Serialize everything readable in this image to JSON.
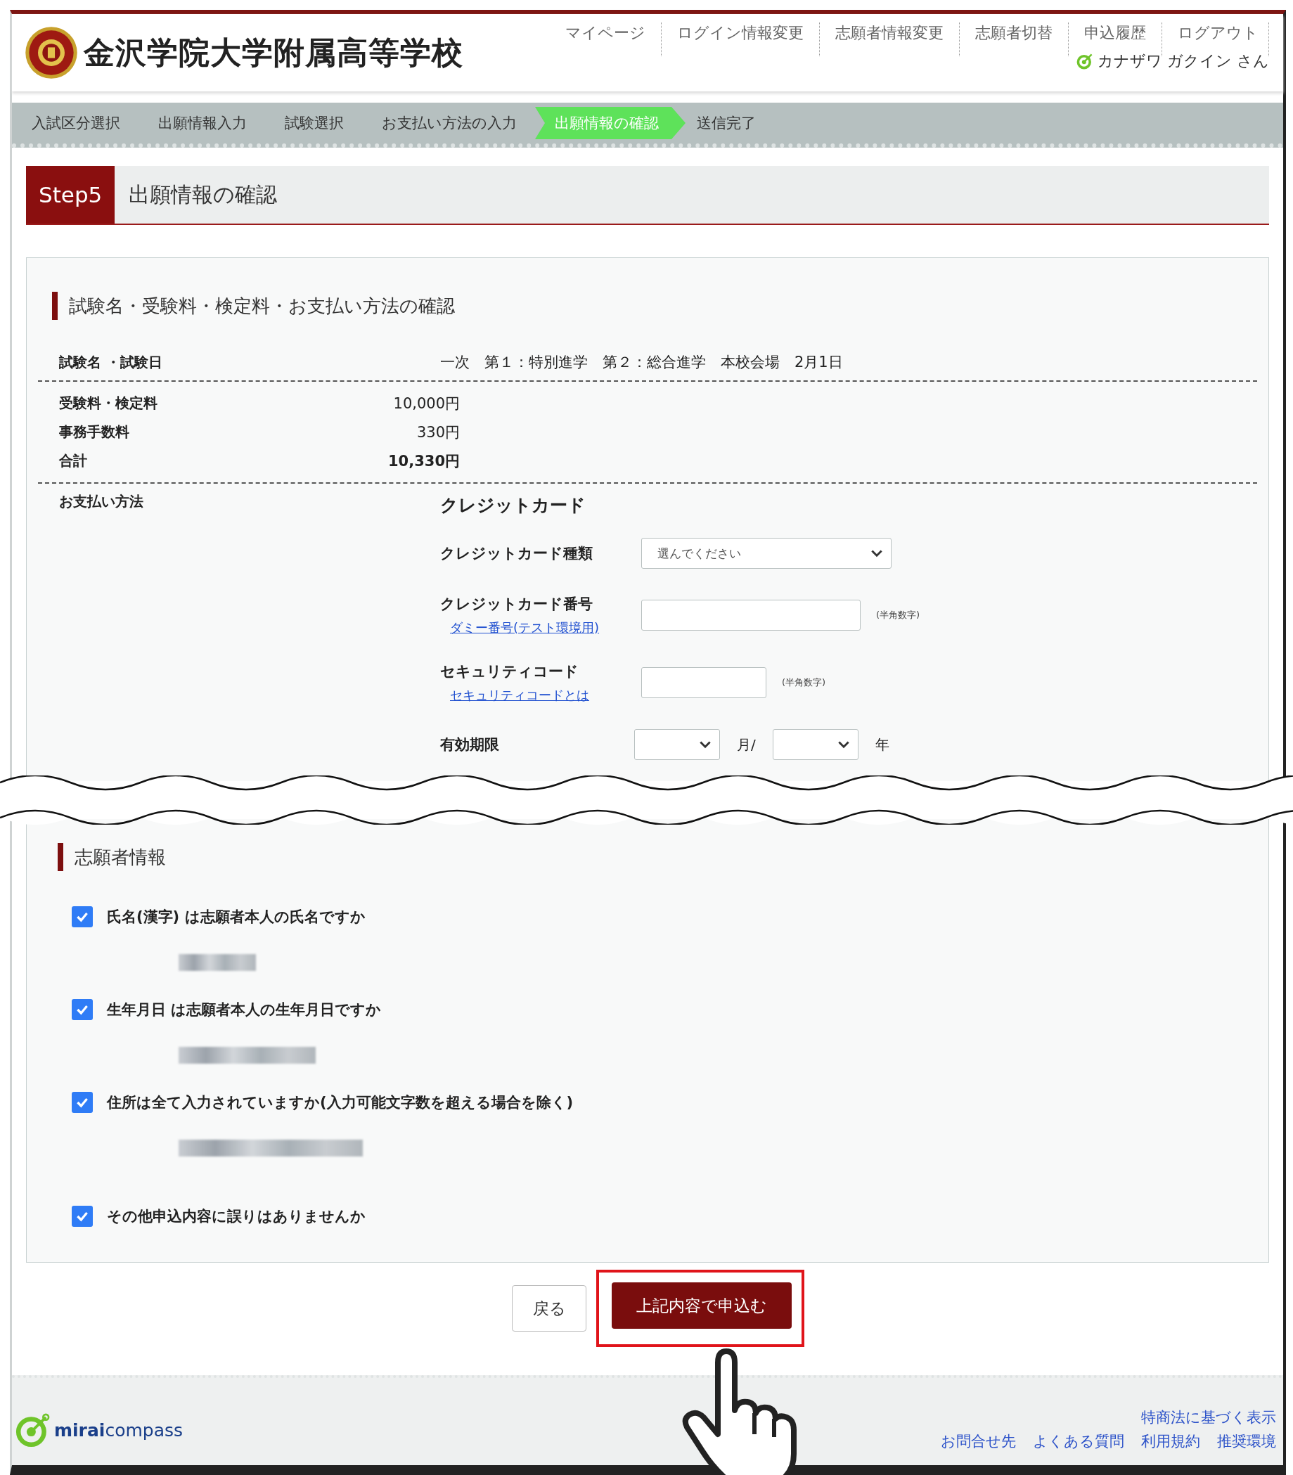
{
  "header": {
    "school_name": "金沢学院大学附属高等学校",
    "nav": [
      "マイページ",
      "ログイン情報変更",
      "志願者情報変更",
      "志願者切替",
      "申込履歴",
      "ログアウト"
    ],
    "user_name": "カナザワ ガクイン さん"
  },
  "steps": [
    {
      "label": "入試区分選択",
      "selected": false
    },
    {
      "label": "出願情報入力",
      "selected": false
    },
    {
      "label": "試験選択",
      "selected": false
    },
    {
      "label": "お支払い方法の入力",
      "selected": false
    },
    {
      "label": "出願情報の確認",
      "selected": true
    },
    {
      "label": "送信完了",
      "selected": false
    }
  ],
  "page_title": {
    "step": "Step5",
    "title": "出願情報の確認"
  },
  "exam_section": {
    "heading": "試験名・受験料・検定料・お支払い方法の確認",
    "exam_label": "試験名 ・試験日",
    "exam_value": "一次　第１：特別進学　第２：総合進学　本校会場　2月1日",
    "fees": [
      {
        "label": "受験料・検定料",
        "value": "10,000円",
        "bold": false
      },
      {
        "label": "事務手数料",
        "value": "330円",
        "bold": false
      },
      {
        "label": "合計",
        "value": "10,330円",
        "bold": true
      }
    ],
    "payment": {
      "label": "お支払い方法",
      "method": "クレジットカード",
      "fields": [
        {
          "kind": "select",
          "label": "クレジットカード種類",
          "placeholder": "選んでください"
        },
        {
          "label": "クレジットカード番号",
          "link": "ダミー番号(テスト環境用)",
          "note": "(半角数字)",
          "kind": "long_input"
        },
        {
          "label": "セキュリティコード",
          "link": "セキュリティコードとは",
          "note": "(半角数字)",
          "kind": "short_input"
        }
      ],
      "expiry": {
        "label": "有効期限",
        "month_unit": "月/",
        "year_unit": "年"
      }
    }
  },
  "applicant_section": {
    "heading": "志願者情報",
    "checks": [
      {
        "label": "氏名(漢字) は志願者本人の氏名ですか",
        "checked": true,
        "kind": "name"
      },
      {
        "label": "生年月日 は志願者本人の生年月日ですか",
        "checked": true,
        "kind": "birthdate"
      },
      {
        "label": "住所は全て入力されていますか(入力可能文字数を超える場合を除く)",
        "checked": true,
        "kind": "address"
      },
      {
        "label": "その他申込内容に誤りはありませんか",
        "checked": true,
        "kind": "plain"
      }
    ]
  },
  "buttons": {
    "back": "戻る",
    "submit": "上記内容で申込む"
  },
  "footer": {
    "brand_bold": "mirai",
    "brand": "compass",
    "top_link": "特商法に基づく表示",
    "links": [
      "お問合せ先",
      "よくある質問",
      "利用規約",
      "推奨環境"
    ]
  }
}
